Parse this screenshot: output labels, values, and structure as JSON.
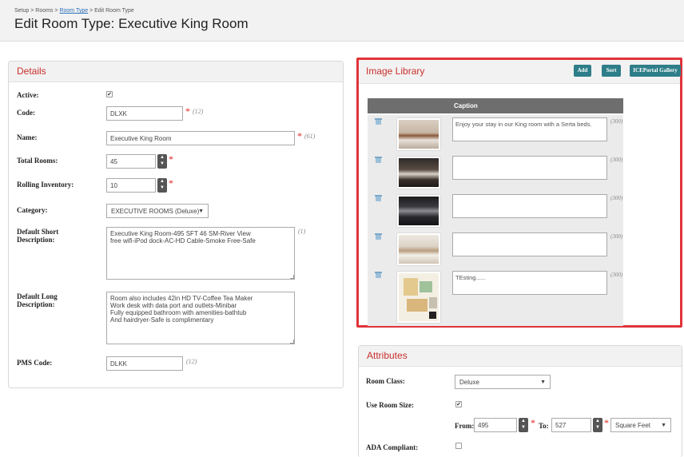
{
  "header": {
    "breadcrumb": [
      "Setup",
      "Rooms",
      "Room Type",
      "Edit Room Type"
    ],
    "title": "Edit Room Type: Executive King Room"
  },
  "details": {
    "heading": "Details",
    "active_label": "Active:",
    "active_checked": "✔",
    "code_label": "Code:",
    "code_value": "DLXK",
    "code_count": "(12)",
    "name_label": "Name:",
    "name_value": "Executive King Room",
    "name_count": "(61)",
    "total_rooms_label": "Total Rooms:",
    "total_rooms_value": "45",
    "rolling_label": "Rolling Inventory:",
    "rolling_value": "10",
    "category_label": "Category:",
    "category_value": "EXECUTIVE ROOMS (Deluxe)",
    "short_desc_label": "Default Short Description:",
    "short_desc_value": "Executive King Room-495 SFT 46 SM-River View\nfree wifi-iPod dock-AC-HD Cable-Smoke Free-Safe",
    "short_desc_count": "(1)",
    "long_desc_label": "Default Long Description:",
    "long_desc_value": "Room also includes 42in HD TV-Coffee Tea Maker\nWork desk with data port and outlets-Minibar\nFully equipped bathroom with amenities-bathtub\nAnd hairdryer-Safe is complimentary",
    "pms_label": "PMS Code:",
    "pms_value": "DLKK",
    "pms_count": "(12)",
    "required_mark": "*"
  },
  "image_library": {
    "heading": "Image Library",
    "buttons": {
      "add": "Add",
      "sort": "Sort",
      "iceportal": "ICEPortal Gallery"
    },
    "caption_header": "Caption",
    "rows": [
      {
        "caption": "Enjoy your stay in our King room with a Serta beds.",
        "count": "(300)",
        "thumb": "bedroom-photo"
      },
      {
        "caption": "",
        "count": "(300)",
        "thumb": "living-room-photo"
      },
      {
        "caption": "",
        "count": "(300)",
        "thumb": "lounge-photo"
      },
      {
        "caption": "",
        "count": "(300)",
        "thumb": "bright-bedroom-photo"
      },
      {
        "caption": "TEsting......",
        "count": "(300)",
        "thumb": "floor-plan"
      }
    ],
    "highlight_color": "#e0343a"
  },
  "attributes": {
    "heading": "Attributes",
    "room_class_label": "Room Class:",
    "room_class_value": "Deluxe",
    "use_room_size_label": "Use Room Size:",
    "use_room_size_checked": "✔",
    "from_label": "From:",
    "from_value": "495",
    "to_label": "To:",
    "to_value": "527",
    "unit_value": "Square Feet",
    "ada_label": "ADA Compliant:"
  },
  "colors": {
    "accent": "#c9302c",
    "button": "#2e7e89"
  }
}
